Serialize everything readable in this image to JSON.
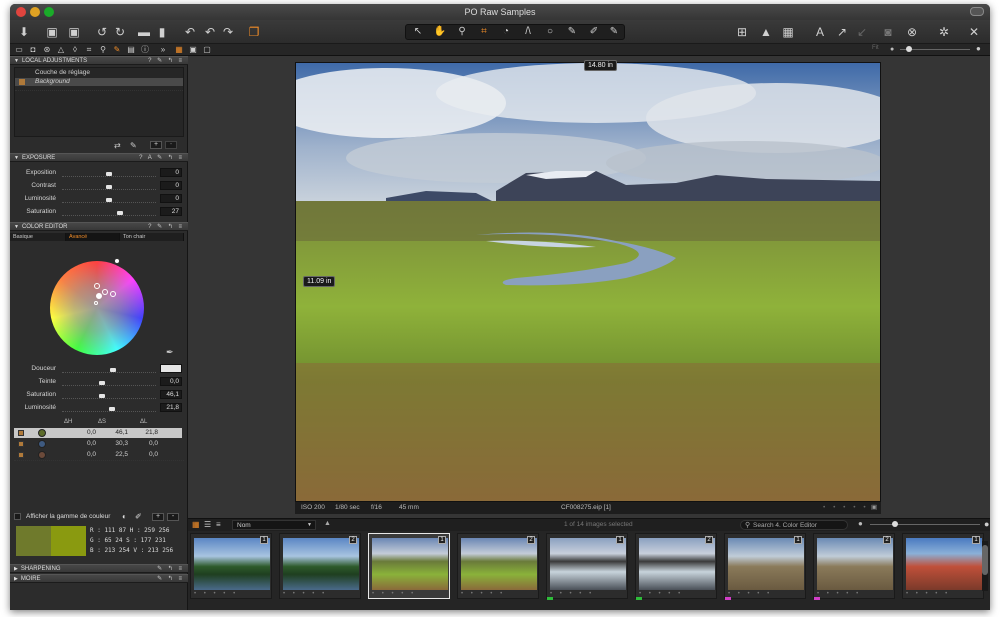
{
  "window": {
    "title": "PO Raw Samples"
  },
  "toolbar": {
    "left_icons": [
      "import-icon",
      "capture-icon",
      "process-icon",
      "rotate-left-icon",
      "rotate-right-icon",
      "new-folder-icon",
      "trash-icon",
      "undo-icon",
      "redo-icon",
      "forward-icon",
      "stack-icon"
    ],
    "tools": [
      "pointer-icon",
      "pan-icon",
      "zoom-icon",
      "crop-icon",
      "rotate-tool-icon",
      "keystone-icon",
      "spot-icon",
      "picker-icon",
      "brush-icon",
      "eraser-icon"
    ],
    "right_icons": [
      "grid-icon",
      "warning-icon",
      "overlay-icon",
      "text-icon",
      "arrow-up-icon",
      "arrow-down-icon",
      "camera-icon",
      "cancel-icon",
      "settings-icon",
      "tools-icon"
    ]
  },
  "toolsrow": {
    "fit_label": "Fit"
  },
  "local_adjustments": {
    "header": "LOCAL ADJUSTMENTS",
    "layers": [
      {
        "name": "Couche de réglage",
        "selected": false
      },
      {
        "name": "Background",
        "selected": true
      }
    ]
  },
  "exposure": {
    "header": "EXPOSURE",
    "sliders": [
      {
        "label": "Exposition",
        "value": "0",
        "pos": 0.5
      },
      {
        "label": "Contrast",
        "value": "0",
        "pos": 0.5
      },
      {
        "label": "Luminosité",
        "value": "0",
        "pos": 0.5
      },
      {
        "label": "Saturation",
        "value": "27",
        "pos": 0.63
      }
    ]
  },
  "color_editor": {
    "header": "COLOR EDITOR",
    "tabs": [
      "Basique",
      "Avancé",
      "Ton chair"
    ],
    "active_tab": "Avancé",
    "sliders": [
      {
        "label": "Douceur",
        "value": "",
        "pos": 0.55
      },
      {
        "label": "Teinte",
        "value": "0,0",
        "pos": 0.42
      },
      {
        "label": "Saturation",
        "value": "46,1",
        "pos": 0.42
      },
      {
        "label": "Luminosité",
        "value": "21,8",
        "pos": 0.53
      }
    ],
    "table_headers": [
      "ΔH",
      "ΔS",
      "ΔL"
    ],
    "rows": [
      {
        "color": "#5c6b2a",
        "dh": "0,0",
        "ds": "46,1",
        "dl": "21,8",
        "selected": true
      },
      {
        "color": "#3e5a80",
        "dh": "0,0",
        "ds": "30,3",
        "dl": "0,0",
        "selected": false
      },
      {
        "color": "#6b4a3a",
        "dh": "0,0",
        "ds": "22,5",
        "dl": "0,0",
        "selected": false
      }
    ],
    "gamut_label": "Afficher la gamme de couleur",
    "swatch_left": "#6f7a2c",
    "swatch_right": "#8a9a10",
    "readout": [
      "R : 111   87 H : 259 256",
      "G :   65   24 S : 177 231",
      "B : 213 254 V : 213 256"
    ]
  },
  "sharpening": {
    "header": "SHARPENING"
  },
  "moire": {
    "header": "MOIRE"
  },
  "viewer": {
    "width_label": "14.80 in",
    "height_label": "11.09 in",
    "iso": "ISO 200",
    "shutter": "1/80 sec",
    "aperture": "f/16",
    "focal": "45 mm",
    "filename": "CF008275.eip [1]"
  },
  "browser": {
    "sort_label": "Nom",
    "count_label": "1 of 14 images selected",
    "search_placeholder": "Search 4. Color Editor",
    "thumbs": [
      {
        "num": "1",
        "type": "house",
        "selected": false,
        "tag": ""
      },
      {
        "num": "2",
        "type": "house",
        "selected": false,
        "tag": ""
      },
      {
        "num": "1",
        "type": "marsh",
        "selected": true,
        "tag": ""
      },
      {
        "num": "2",
        "type": "marsh",
        "selected": false,
        "tag": ""
      },
      {
        "num": "1",
        "type": "sea",
        "selected": false,
        "tag": "#2ebd3a"
      },
      {
        "num": "2",
        "type": "sea",
        "selected": false,
        "tag": "#2ebd3a"
      },
      {
        "num": "1",
        "type": "beach",
        "selected": false,
        "tag": "#d23fc8"
      },
      {
        "num": "2",
        "type": "beach",
        "selected": false,
        "tag": "#d23fc8"
      },
      {
        "num": "1",
        "type": "rock",
        "selected": false,
        "tag": ""
      }
    ]
  }
}
